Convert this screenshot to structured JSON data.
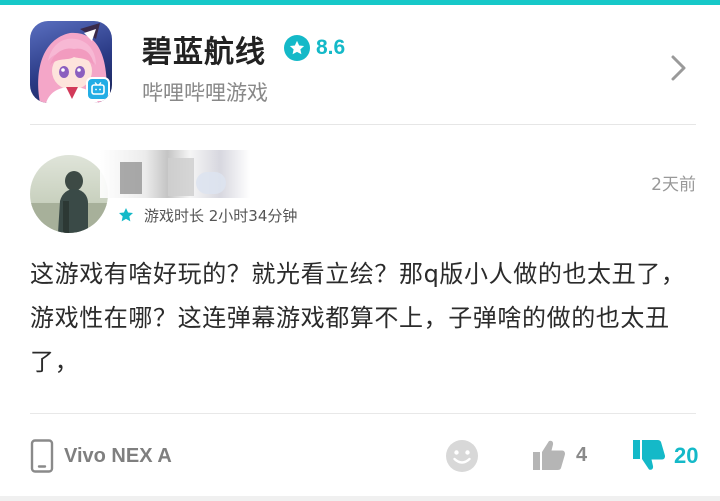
{
  "app": {
    "title": "碧蓝航线",
    "rating": "8.6",
    "publisher": "哔哩哔哩游戏"
  },
  "review": {
    "username": "用户",
    "play_time": "游戏时长 2小时34分钟",
    "time_ago": "2天前",
    "text": "这游戏有啥好玩的？就光看立绘？那q版小人做的也太丑了，游戏性在哪？这连弹幕游戏都算不上，子弹啥的做的也太丑了，",
    "device": "Vivo NEX A",
    "likes": "4",
    "dislikes": "20"
  },
  "colors": {
    "accent": "#14b9c8",
    "top_bar": "#16c8c8",
    "text_primary": "#2b2b2b",
    "text_secondary": "#888888"
  },
  "icons": {
    "rating": "star-icon",
    "navigate": "chevron-right-icon",
    "play_time": "star-icon",
    "device": "phone-icon",
    "emoji": "smiley-icon",
    "like": "thumbs-up-icon",
    "dislike": "thumbs-down-icon"
  }
}
